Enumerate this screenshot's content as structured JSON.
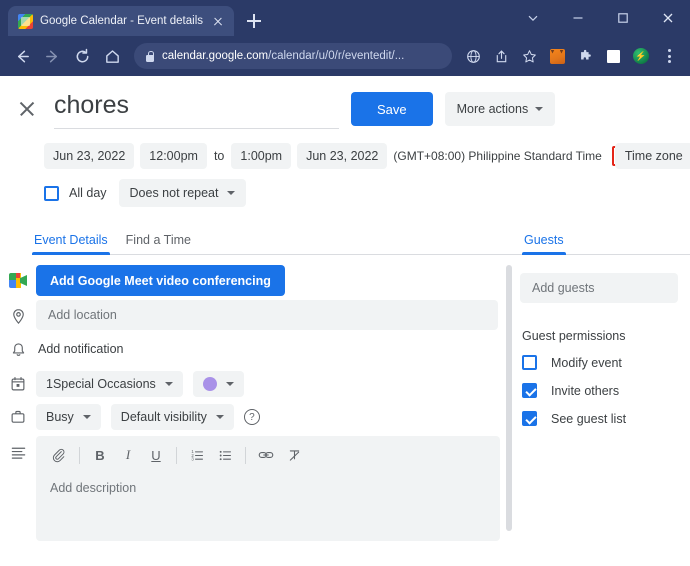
{
  "browser": {
    "tab": {
      "title": "Google Calendar - Event details",
      "favicon": "calendar-favicon",
      "close": "×"
    },
    "newtab_label": "+",
    "window_controls": [
      {
        "name": "tab-search",
        "icon": "chevron-down-icon"
      },
      {
        "name": "minimize",
        "icon": "minimize-icon"
      },
      {
        "name": "maximize",
        "icon": "maximize-icon"
      },
      {
        "name": "close",
        "icon": "close-icon"
      }
    ],
    "nav": {
      "back": "back-arrow-icon",
      "forward": "forward-arrow-icon",
      "reload": "reload-icon",
      "home": "home-icon"
    },
    "omnibox": {
      "lock": "lock-icon",
      "url_bold": "calendar.google.com",
      "url_rest": "/calendar/u/0/r/eventedit/..."
    },
    "toolbar_icons": [
      {
        "name": "translate-icon",
        "label": "translate"
      },
      {
        "name": "share-icon",
        "label": "share"
      },
      {
        "name": "bookmark-star-icon",
        "label": "bookmark"
      },
      {
        "name": "metamask-extension-icon",
        "label": "MetaMask"
      },
      {
        "name": "extensions-puzzle-icon",
        "label": "Extensions"
      },
      {
        "name": "side-panel-icon",
        "label": "Side panel"
      },
      {
        "name": "green-extension-icon",
        "label": "extension"
      },
      {
        "name": "chrome-menu-icon",
        "label": "Customize and control"
      }
    ]
  },
  "header": {
    "close_label": "close-event-editor",
    "event_title": "chores",
    "save_label": "Save",
    "more_actions_label": "More actions"
  },
  "datetime": {
    "start_date": "Jun 23, 2022",
    "start_time": "12:00pm",
    "to_label": "to",
    "end_time": "1:00pm",
    "end_date": "Jun 23, 2022",
    "timezone_text": "(GMT+08:00) Philippine Standard Time",
    "timezone_button": "Time zone",
    "highlight_color": "#e42518"
  },
  "options": {
    "all_day_label": "All day",
    "all_day_checked": false,
    "repeat_label": "Does not repeat"
  },
  "tabs": {
    "event_details": "Event Details",
    "find_a_time": "Find a Time",
    "guests": "Guests",
    "active": "Event Details",
    "accent_color": "#1a73e8"
  },
  "details": {
    "meet_button": "Add Google Meet video conferencing",
    "meet_icon": "google-meet-icon",
    "location_icon": "location-pin-icon",
    "location_placeholder": "Add location",
    "notification_icon": "bell-icon",
    "notification_label": "Add notification",
    "calendar_icon": "calendar-icon",
    "calendar_name": "1Special Occasions",
    "event_color": "#a991e8",
    "busy_icon": "briefcase-icon",
    "busy_label": "Busy",
    "visibility_label": "Default visibility",
    "help_icon": "help-circle-icon",
    "description_icon": "description-lines-icon",
    "description_placeholder": "Add description",
    "description_toolbar": [
      {
        "name": "attach-icon",
        "glyph": "📎"
      },
      {
        "name": "bold-icon",
        "glyph": "B"
      },
      {
        "name": "italic-icon",
        "glyph": "I"
      },
      {
        "name": "underline-icon",
        "glyph": "U"
      },
      {
        "name": "numbered-list-icon",
        "glyph": "☰"
      },
      {
        "name": "bulleted-list-icon",
        "glyph": "☰"
      },
      {
        "name": "link-icon",
        "glyph": "🔗"
      },
      {
        "name": "clear-formatting-icon",
        "glyph": "T"
      }
    ]
  },
  "guests": {
    "add_guests_placeholder": "Add guests",
    "permissions_title": "Guest permissions",
    "permissions": [
      {
        "label": "Modify event",
        "checked": false
      },
      {
        "label": "Invite others",
        "checked": true
      },
      {
        "label": "See guest list",
        "checked": true
      }
    ]
  }
}
